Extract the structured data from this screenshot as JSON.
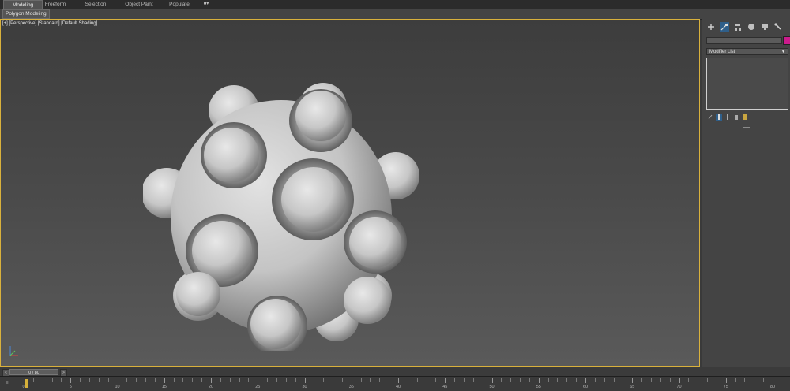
{
  "ribbon": {
    "tabs": [
      {
        "label": "Modeling",
        "active": true
      },
      {
        "label": "Freeform",
        "active": false
      },
      {
        "label": "Selection",
        "active": false
      },
      {
        "label": "Object Paint",
        "active": false
      },
      {
        "label": "Populate",
        "active": false
      }
    ],
    "panel_label": "Polygon Modeling"
  },
  "viewport": {
    "label": "[+] [Perspective] [Standard] [Default Shading]",
    "border_color": "#d9b13c",
    "object": "sphere-with-bumps"
  },
  "command_panel": {
    "tabs": [
      "create-icon",
      "modify-icon",
      "hierarchy-icon",
      "motion-icon",
      "display-icon",
      "utilities-icon"
    ],
    "object_color": "#cc1b8c",
    "modifier_list_label": "Modifier List",
    "stack_tools": [
      "pin-stack-icon",
      "show-end-result-icon",
      "make-unique-icon",
      "remove-modifier-icon",
      "configure-sets-icon"
    ]
  },
  "time_slider": {
    "label": "0 / 80",
    "prev": "<",
    "next": ">"
  },
  "track_bar": {
    "icon_label": "≡",
    "ticks": [
      "0",
      "5",
      "10",
      "15",
      "20",
      "25",
      "30",
      "35",
      "40",
      "45",
      "50",
      "55",
      "60",
      "65",
      "70",
      "75",
      "80"
    ],
    "current_frame": 0,
    "marker_color": "#d6b03a"
  }
}
